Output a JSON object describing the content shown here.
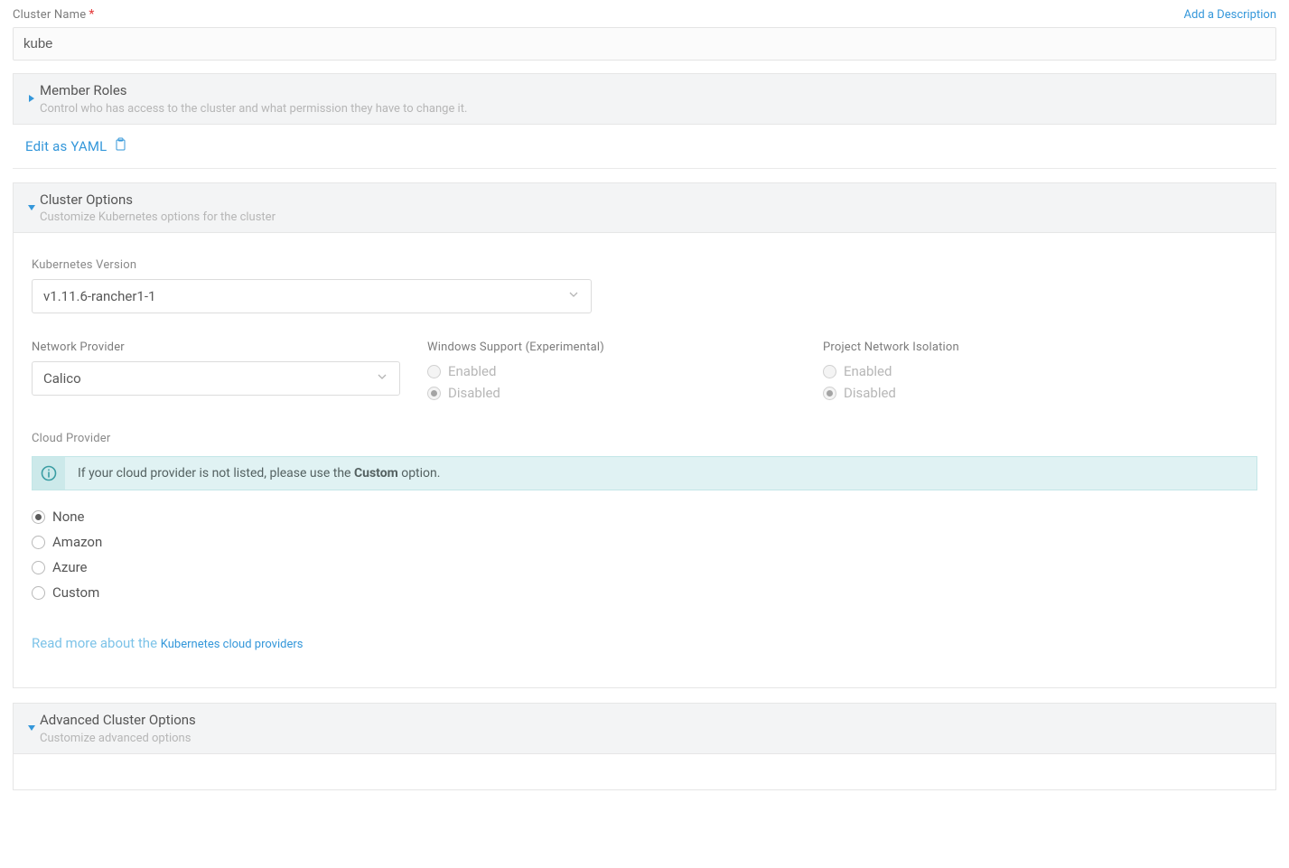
{
  "labels": {
    "cluster_name": "Cluster Name",
    "add_description": "Add a Description",
    "edit_yaml": "Edit as YAML",
    "k8s_version": "Kubernetes Version",
    "network_provider": "Network Provider",
    "windows_support": "Windows Support (Experimental)",
    "project_isolation": "Project Network Isolation",
    "enabled": "Enabled",
    "disabled": "Disabled",
    "cloud_provider": "Cloud Provider",
    "readmore_prefix": "Read more about the ",
    "readmore_link": "Kubernetes cloud providers"
  },
  "values": {
    "cluster_name": "kube",
    "k8s_version": "v1.11.6-rancher1-1",
    "network_provider": "Calico"
  },
  "sections": {
    "member_roles": {
      "title": "Member Roles",
      "sub": "Control who has access to the cluster and what permission they have to change it."
    },
    "cluster_options": {
      "title": "Cluster Options",
      "sub": "Customize Kubernetes options for the cluster"
    },
    "advanced": {
      "title": "Advanced Cluster Options",
      "sub": "Customize advanced options"
    }
  },
  "info_banner": {
    "prefix": "If your cloud provider is not listed, please use the ",
    "bold": "Custom",
    "suffix": " option."
  },
  "cloud_providers": {
    "none": "None",
    "amazon": "Amazon",
    "azure": "Azure",
    "custom": "Custom"
  }
}
